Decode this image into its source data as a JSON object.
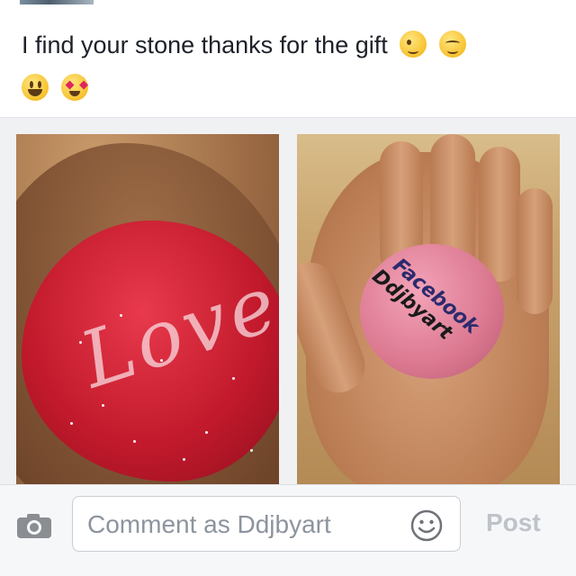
{
  "post": {
    "text": "I find your stone thanks for the gift",
    "emoji_line1": [
      "winking-face",
      "smiling-face"
    ],
    "emoji_line2": [
      "grinning-face",
      "heart-eyes-face"
    ]
  },
  "photos": {
    "left": {
      "stone_text": "Love",
      "stone_color": "#c21a2c"
    },
    "right": {
      "stone_text_line1": "Facebook",
      "stone_text_line2": "Ddjbyart",
      "stone_color": "#db7890"
    }
  },
  "comment_bar": {
    "placeholder": "Comment as Ddjbyart",
    "post_label": "Post",
    "camera_icon": "camera-icon",
    "emoji_icon": "smiley-icon"
  },
  "colors": {
    "text": "#1d2129",
    "placeholder": "#8d949e",
    "post_disabled": "#bec3c9",
    "bar_bg": "#f6f7f9"
  }
}
